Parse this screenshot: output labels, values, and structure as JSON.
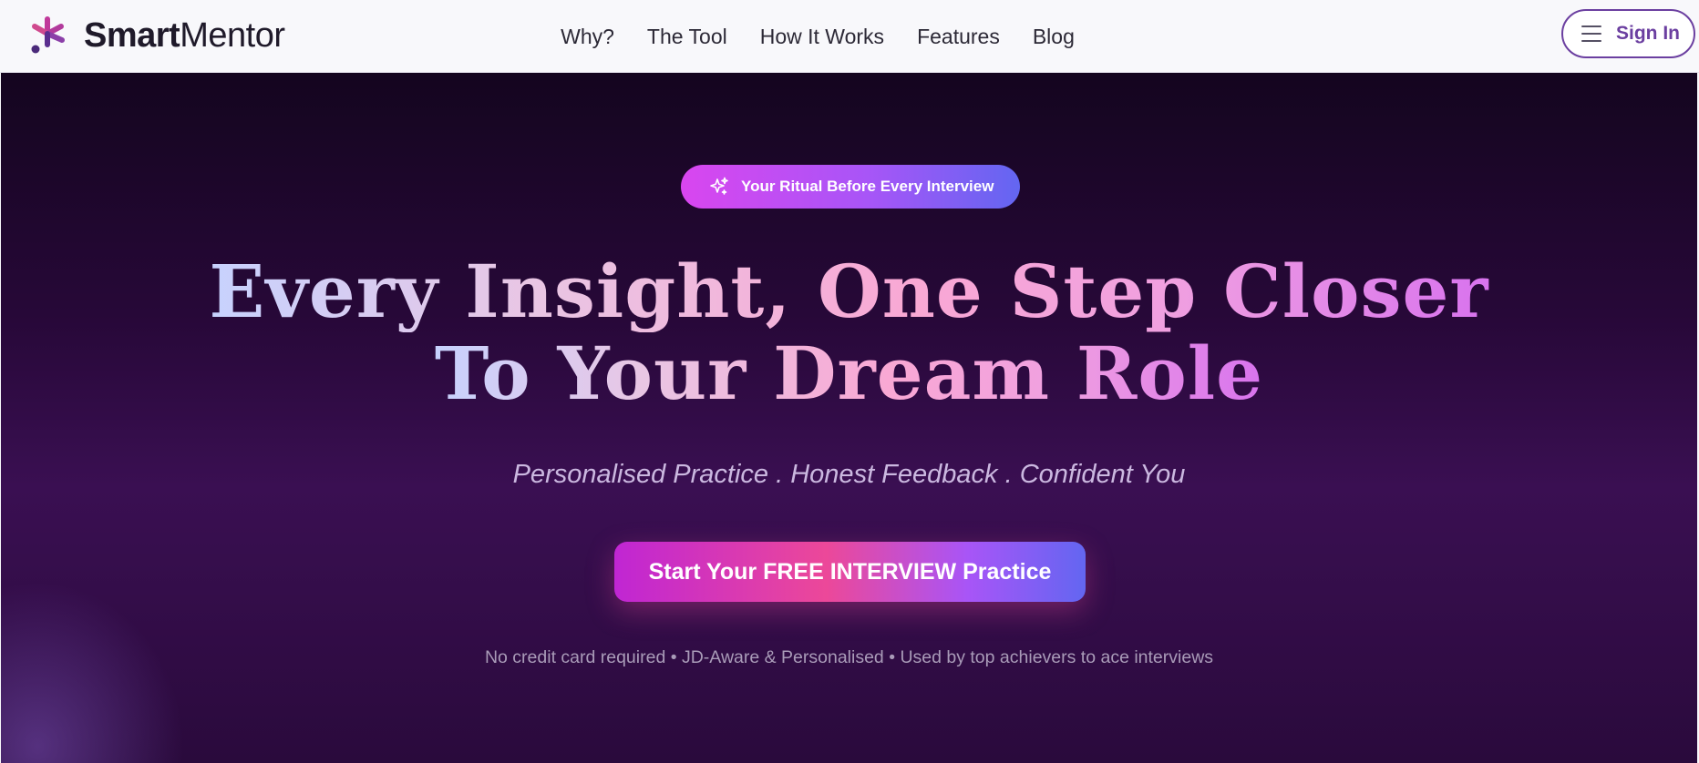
{
  "brand": {
    "name_bold": "Smart",
    "name_light": "Mentor",
    "accent": "#6b3fa0"
  },
  "nav": {
    "items": [
      {
        "label": "Why?"
      },
      {
        "label": "The Tool"
      },
      {
        "label": "How It Works"
      },
      {
        "label": "Features"
      },
      {
        "label": "Blog"
      }
    ],
    "signin_label": "Sign In"
  },
  "hero": {
    "badge": "Your Ritual Before Every Interview",
    "headline_line1": "Every Insight, One Step Closer",
    "headline_line2": "To Your Dream Role",
    "subtitle": "Personalised Practice . Honest Feedback . Confident You",
    "cta_label": "Start Your FREE INTERVIEW Practice",
    "footnote": "No credit card required • JD-Aware & Personalised • Used by top achievers to ace interviews"
  },
  "icons": {
    "logo": "smartmentor-logo-icon",
    "menu": "hamburger-icon",
    "badge": "sparkles-icon"
  },
  "colors": {
    "hero_bg_top": "#14051f",
    "hero_bg_mid": "#3a0f52",
    "cta_start": "#c026d3",
    "cta_mid": "#ec4899",
    "cta_end": "#6366f1"
  }
}
